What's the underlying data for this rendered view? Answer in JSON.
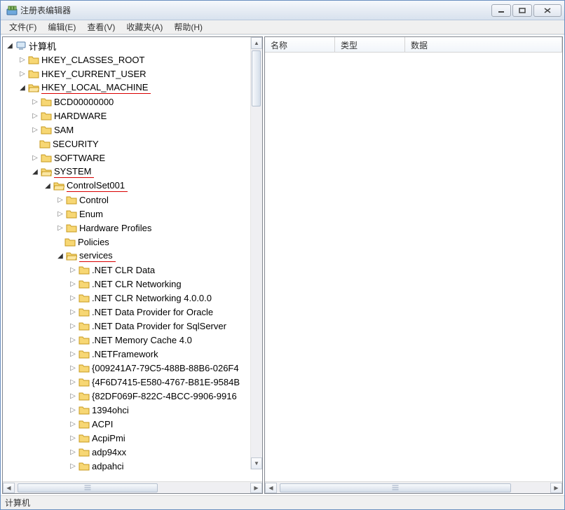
{
  "window": {
    "title": "注册表编辑器"
  },
  "menu": {
    "file": "文件(F)",
    "edit": "编辑(E)",
    "view": "查看(V)",
    "favorites": "收藏夹(A)",
    "help": "帮助(H)"
  },
  "tree": {
    "root": "计算机",
    "hkcr": "HKEY_CLASSES_ROOT",
    "hkcu": "HKEY_CURRENT_USER",
    "hklm": "HKEY_LOCAL_MACHINE",
    "hklm_children": {
      "bcd": "BCD00000000",
      "hardware": "HARDWARE",
      "sam": "SAM",
      "security": "SECURITY",
      "software": "SOFTWARE",
      "system": "SYSTEM"
    },
    "system_children": {
      "cs001": "ControlSet001"
    },
    "cs001_children": {
      "control": "Control",
      "enum": "Enum",
      "hwprofiles": "Hardware Profiles",
      "policies": "Policies",
      "services": "services"
    },
    "services_children": [
      ".NET CLR Data",
      ".NET CLR Networking",
      ".NET CLR Networking 4.0.0.0",
      ".NET Data Provider for Oracle",
      ".NET Data Provider for SqlServer",
      ".NET Memory Cache 4.0",
      ".NETFramework",
      "{009241A7-79C5-488B-88B6-026F4",
      "{4F6D7415-E580-4767-B81E-9584B",
      "{82DF069F-822C-4BCC-9906-9916",
      "1394ohci",
      "ACPI",
      "AcpiPmi",
      "adp94xx",
      "adpahci"
    ]
  },
  "list": {
    "col_name": "名称",
    "col_type": "类型",
    "col_data": "数据"
  },
  "status": {
    "path": "计算机"
  }
}
